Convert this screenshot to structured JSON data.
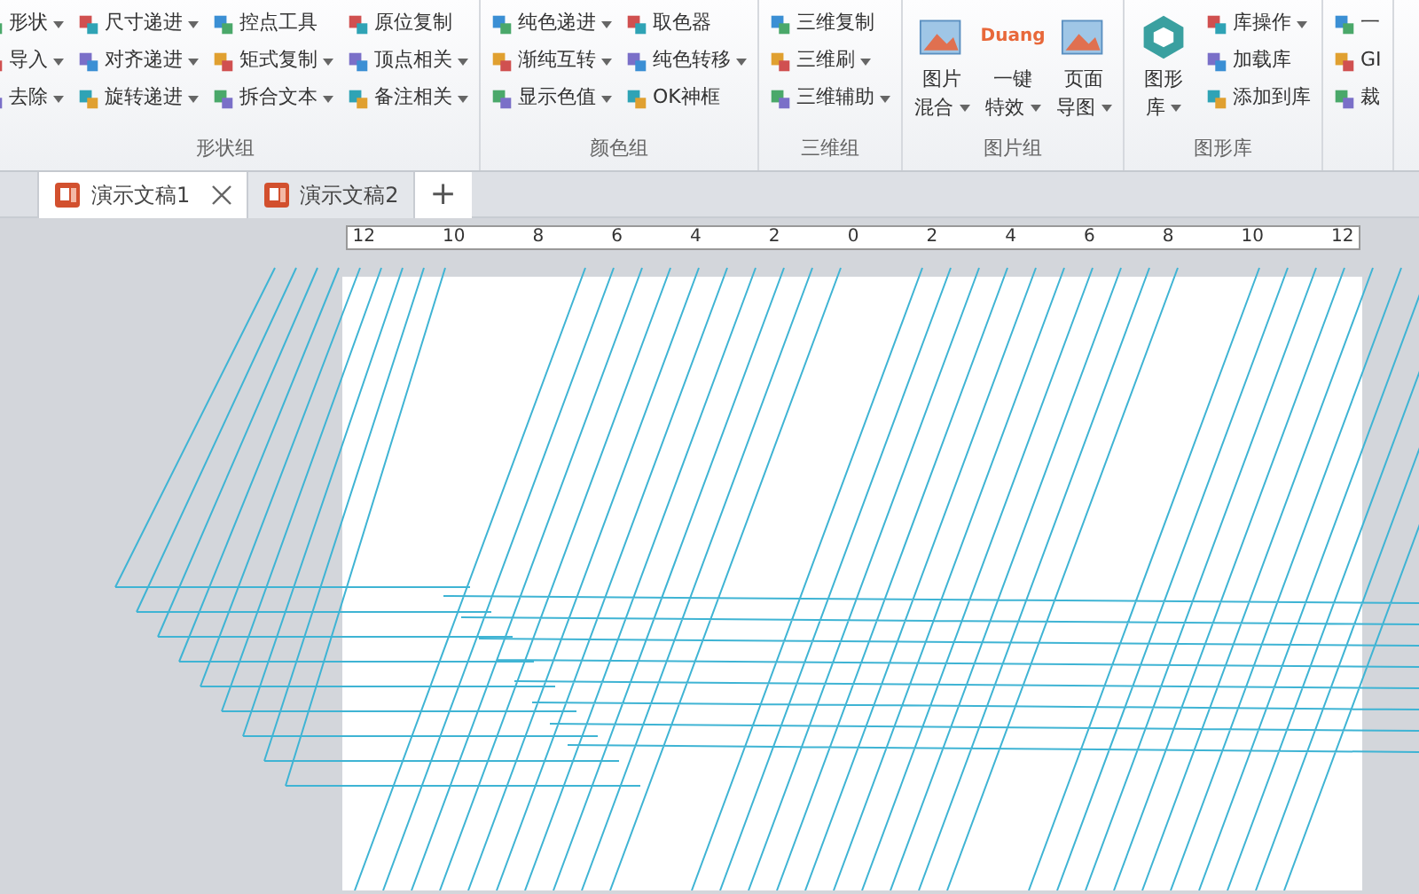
{
  "ribbon": {
    "groups": [
      {
        "label": "形状组",
        "kind": "small",
        "columns": [
          [
            {
              "label": "形状",
              "dropdown": true
            },
            {
              "label": "导入",
              "dropdown": true
            },
            {
              "label": "去除",
              "dropdown": true
            }
          ],
          [
            {
              "label": "尺寸递进",
              "dropdown": true
            },
            {
              "label": "对齐递进",
              "dropdown": true
            },
            {
              "label": "旋转递进",
              "dropdown": true
            }
          ],
          [
            {
              "label": "控点工具",
              "dropdown": false
            },
            {
              "label": "矩式复制",
              "dropdown": true
            },
            {
              "label": "拆合文本",
              "dropdown": true
            }
          ],
          [
            {
              "label": "原位复制",
              "dropdown": false
            },
            {
              "label": "顶点相关",
              "dropdown": true
            },
            {
              "label": "备注相关",
              "dropdown": true
            }
          ]
        ]
      },
      {
        "label": "颜色组",
        "kind": "small",
        "columns": [
          [
            {
              "label": "纯色递进",
              "dropdown": true
            },
            {
              "label": "渐纯互转",
              "dropdown": true
            },
            {
              "label": "显示色值",
              "dropdown": true
            }
          ],
          [
            {
              "label": "取色器",
              "dropdown": false
            },
            {
              "label": "纯色转移",
              "dropdown": true
            },
            {
              "label": "OK神框",
              "dropdown": false
            }
          ]
        ]
      },
      {
        "label": "三维组",
        "kind": "small",
        "columns": [
          [
            {
              "label": "三维复制",
              "dropdown": false
            },
            {
              "label": "三维刷",
              "dropdown": true
            },
            {
              "label": "三维辅助",
              "dropdown": true
            }
          ]
        ]
      },
      {
        "label": "图片组",
        "kind": "large",
        "buttons": [
          {
            "lines": [
              "图片",
              "混合"
            ],
            "dropdown": true
          },
          {
            "lines": [
              "一键",
              "特效"
            ],
            "dropdown": true,
            "icon_text": "Duang"
          },
          {
            "lines": [
              "页面",
              "导图"
            ],
            "dropdown": true
          }
        ]
      },
      {
        "label": "图形库",
        "kind": "large",
        "buttons": [
          {
            "lines": [
              "图形",
              "库"
            ],
            "dropdown": true
          }
        ],
        "columns": [
          [
            {
              "label": "库操作",
              "dropdown": true
            },
            {
              "label": "加载库",
              "dropdown": false
            },
            {
              "label": "添加到库",
              "dropdown": false
            }
          ]
        ]
      },
      {
        "kind": "small",
        "columns": [
          [
            {
              "label": "一",
              "dropdown": false
            },
            {
              "label": "GI",
              "dropdown": false
            },
            {
              "label": "裁",
              "dropdown": false
            }
          ]
        ]
      }
    ]
  },
  "tabs": [
    {
      "label": "演示文稿1",
      "selected": true,
      "closable": true
    },
    {
      "label": "演示文稿2",
      "selected": false,
      "closable": false
    }
  ],
  "new_tab": "+",
  "ruler": {
    "labels": [
      "12",
      "10",
      "8",
      "6",
      "4",
      "2",
      "0",
      "2",
      "4",
      "6",
      "8",
      "10",
      "12"
    ]
  }
}
